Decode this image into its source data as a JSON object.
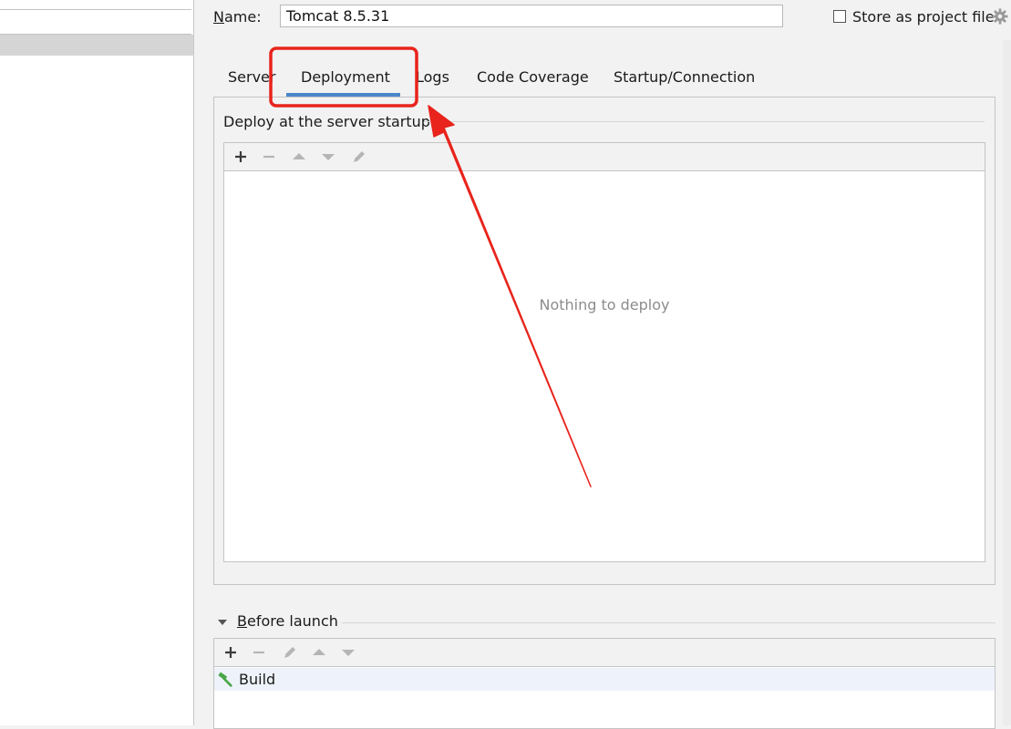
{
  "config": {
    "name_label": "Name:",
    "name_value": "Tomcat 8.5.31",
    "store_label": "Store as project file",
    "store_checked": false
  },
  "tabs": [
    {
      "label": "Server",
      "active": false
    },
    {
      "label": "Deployment",
      "active": true
    },
    {
      "label": "Logs",
      "active": false
    },
    {
      "label": "Code Coverage",
      "active": false
    },
    {
      "label": "Startup/Connection",
      "active": false
    }
  ],
  "deployment": {
    "title": "Deploy at the server startup",
    "empty_text": "Nothing to deploy",
    "toolbar": [
      "add-icon",
      "remove-icon",
      "move-up-icon",
      "move-down-icon",
      "edit-icon"
    ]
  },
  "before_launch": {
    "title": "Before launch",
    "toolbar": [
      "add-icon",
      "remove-icon",
      "edit-icon",
      "move-up-icon",
      "move-down-icon"
    ],
    "items": [
      {
        "label": "Build",
        "icon": "build-hammer-icon"
      }
    ]
  },
  "colors": {
    "tab_underline": "#4a86c8",
    "annotation_red": "#e8241c",
    "build_icon": "#4aa64a",
    "placeholder_text": "#8c8c8c"
  }
}
